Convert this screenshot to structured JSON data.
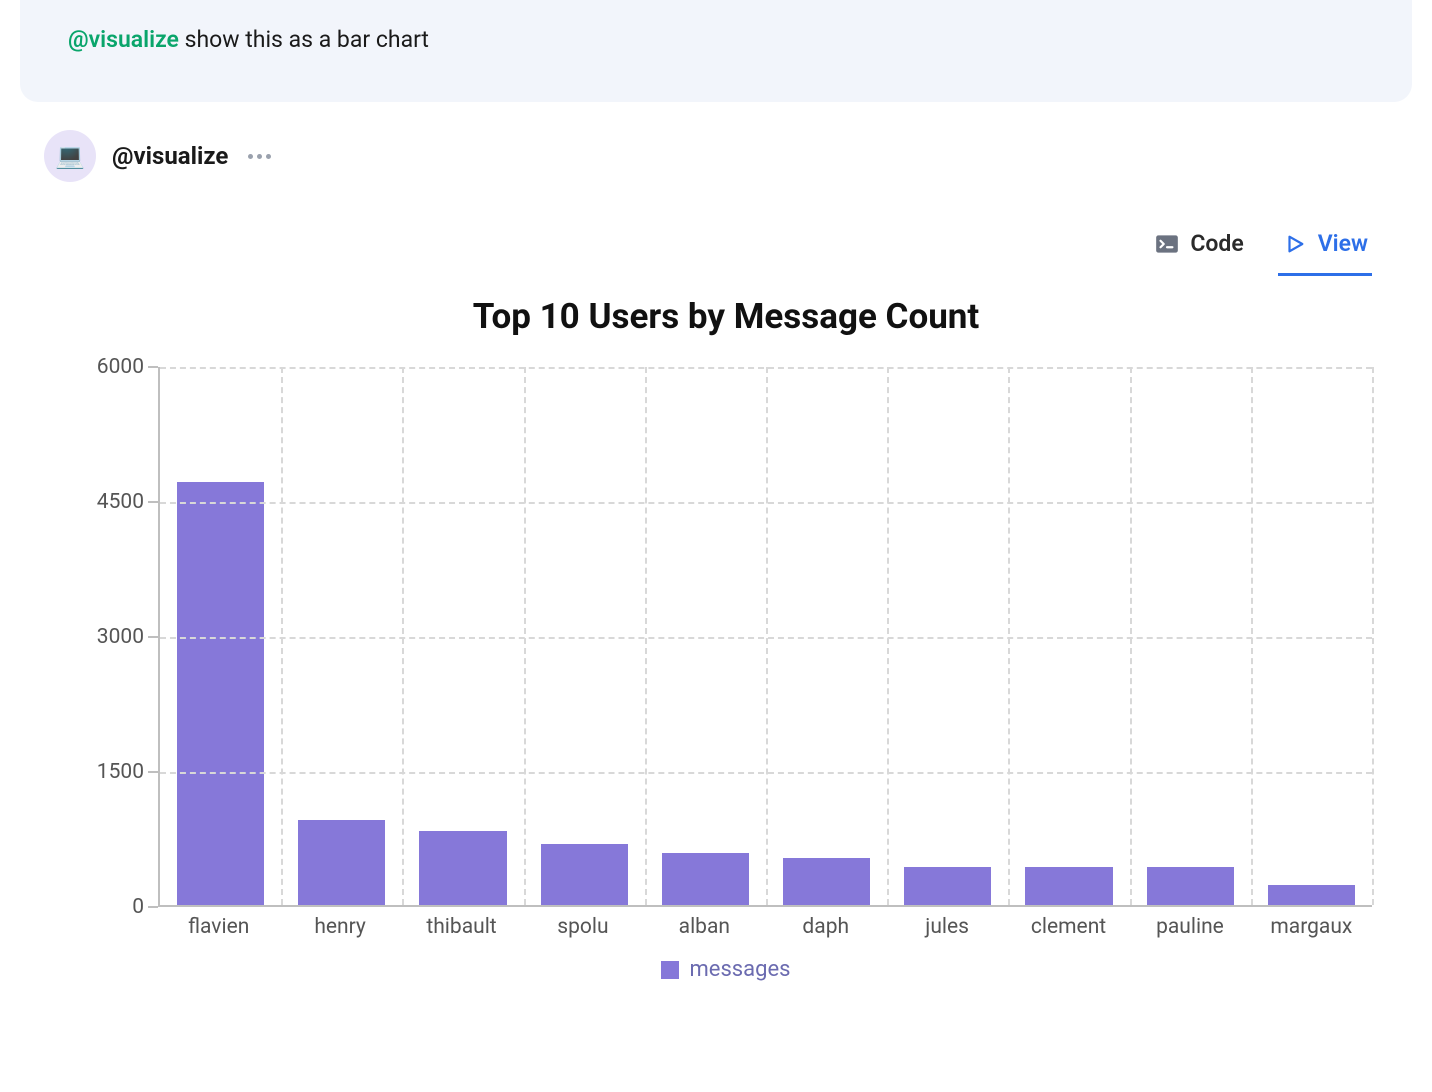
{
  "prompt": {
    "mention": "@visualize",
    "text": " show this as a bar chart"
  },
  "response": {
    "name": "@visualize",
    "avatar_emoji": "💻"
  },
  "tabs": {
    "code": "Code",
    "view": "View",
    "active": "view"
  },
  "chart_data": {
    "type": "bar",
    "title": "Top 10 Users by Message Count",
    "categories": [
      "flavien",
      "henry",
      "thibault",
      "spolu",
      "alban",
      "daph",
      "jules",
      "clement",
      "pauline",
      "margaux"
    ],
    "values": [
      4700,
      950,
      820,
      680,
      580,
      520,
      430,
      430,
      420,
      220
    ],
    "series_name": "messages",
    "ylabel": "",
    "xlabel": "",
    "y_ticks": [
      0,
      1500,
      3000,
      4500,
      6000
    ],
    "ylim": [
      0,
      6000
    ],
    "color": "#8678d9",
    "legend_label": "messages"
  }
}
